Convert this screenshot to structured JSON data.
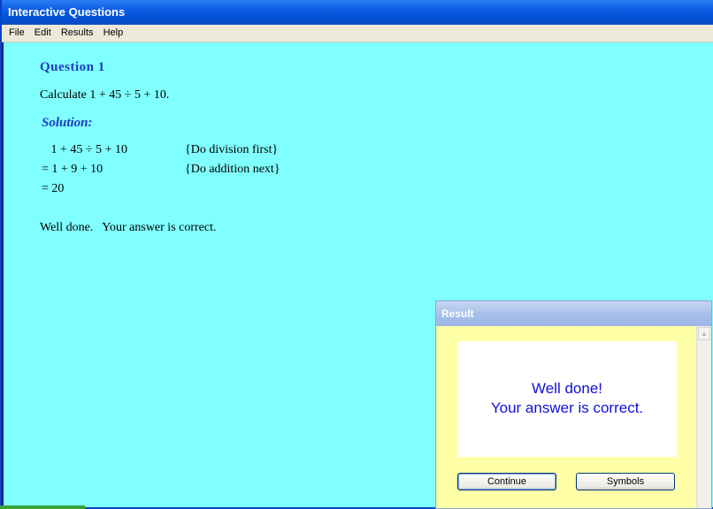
{
  "window": {
    "title": "Interactive Questions"
  },
  "menu": {
    "items": [
      "File",
      "Edit",
      "Results",
      "Help"
    ]
  },
  "question": {
    "title": "Question 1",
    "text": "Calculate 1 + 45 ÷ 5 + 10.",
    "solution_label": "Solution:",
    "steps": [
      {
        "expr": "   1 + 45 ÷ 5 + 10",
        "note": "{Do division first}"
      },
      {
        "expr": "= 1 + 9 + 10",
        "note": "{Do addition next}"
      },
      {
        "expr": "= 20",
        "note": ""
      }
    ],
    "feedback": "Well done.   Your answer is correct."
  },
  "result_dialog": {
    "title": "Result",
    "message_line1": "Well done!",
    "message_line2": "Your answer is correct.",
    "continue_label": "Continue",
    "symbols_label": "Symbols"
  },
  "colors": {
    "content_bg": "#80ffff",
    "dialog_bg": "#ffffa8",
    "accent_blue": "#1f3bbf"
  }
}
